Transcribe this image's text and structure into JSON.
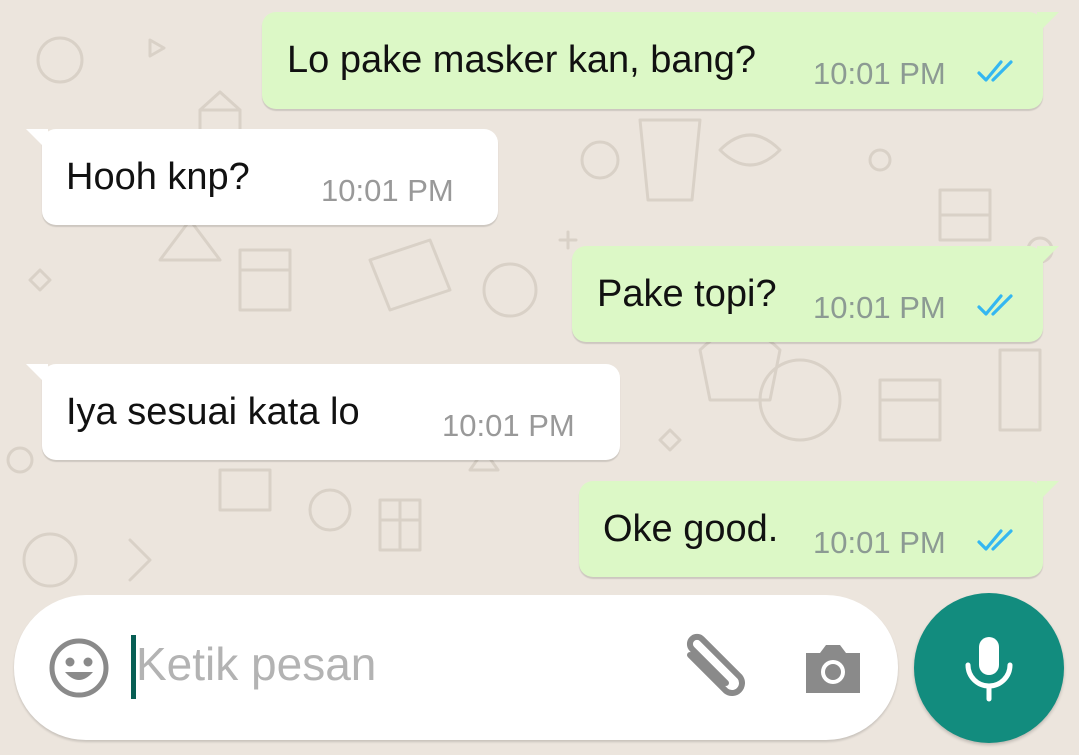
{
  "messages": [
    {
      "direction": "out",
      "text": "Lo pake masker kan, bang?",
      "time": "10:01 PM",
      "status": "read"
    },
    {
      "direction": "in",
      "text": "Hooh knp?",
      "time": "10:01 PM"
    },
    {
      "direction": "out",
      "text": "Pake topi?",
      "time": "10:01 PM",
      "status": "read"
    },
    {
      "direction": "in",
      "text": "Iya sesuai kata lo",
      "time": "10:01 PM"
    },
    {
      "direction": "out",
      "text": "Oke good.",
      "time": "10:01 PM",
      "status": "read"
    }
  ],
  "composer": {
    "placeholder": "Ketik pesan",
    "value": ""
  },
  "icons": {
    "emoji": "emoji-icon",
    "attach": "paperclip-icon",
    "camera": "camera-icon",
    "mic": "microphone-icon",
    "read_receipt": "double-check-icon"
  },
  "colors": {
    "outgoing_bubble": "#dcf8c6",
    "incoming_bubble": "#ffffff",
    "background": "#ece5dd",
    "accent": "#128c7e",
    "read_tick": "#34b7f1"
  }
}
